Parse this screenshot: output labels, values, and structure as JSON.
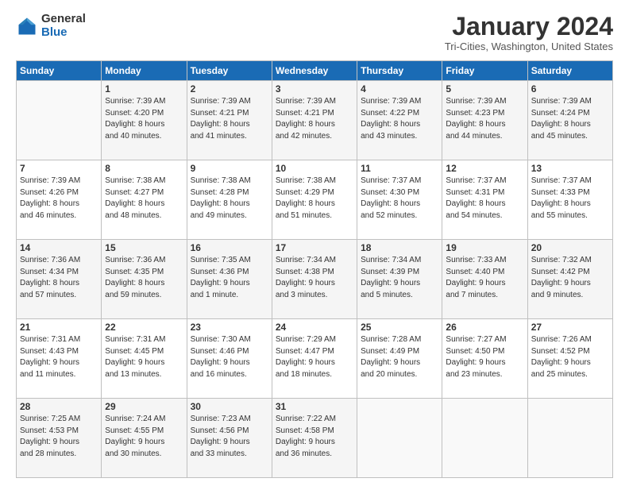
{
  "logo": {
    "general": "General",
    "blue": "Blue"
  },
  "header": {
    "title": "January 2024",
    "subtitle": "Tri-Cities, Washington, United States"
  },
  "weekdays": [
    "Sunday",
    "Monday",
    "Tuesday",
    "Wednesday",
    "Thursday",
    "Friday",
    "Saturday"
  ],
  "weeks": [
    [
      {
        "day": "",
        "info": ""
      },
      {
        "day": "1",
        "info": "Sunrise: 7:39 AM\nSunset: 4:20 PM\nDaylight: 8 hours\nand 40 minutes."
      },
      {
        "day": "2",
        "info": "Sunrise: 7:39 AM\nSunset: 4:21 PM\nDaylight: 8 hours\nand 41 minutes."
      },
      {
        "day": "3",
        "info": "Sunrise: 7:39 AM\nSunset: 4:21 PM\nDaylight: 8 hours\nand 42 minutes."
      },
      {
        "day": "4",
        "info": "Sunrise: 7:39 AM\nSunset: 4:22 PM\nDaylight: 8 hours\nand 43 minutes."
      },
      {
        "day": "5",
        "info": "Sunrise: 7:39 AM\nSunset: 4:23 PM\nDaylight: 8 hours\nand 44 minutes."
      },
      {
        "day": "6",
        "info": "Sunrise: 7:39 AM\nSunset: 4:24 PM\nDaylight: 8 hours\nand 45 minutes."
      }
    ],
    [
      {
        "day": "7",
        "info": "Sunrise: 7:39 AM\nSunset: 4:26 PM\nDaylight: 8 hours\nand 46 minutes."
      },
      {
        "day": "8",
        "info": "Sunrise: 7:38 AM\nSunset: 4:27 PM\nDaylight: 8 hours\nand 48 minutes."
      },
      {
        "day": "9",
        "info": "Sunrise: 7:38 AM\nSunset: 4:28 PM\nDaylight: 8 hours\nand 49 minutes."
      },
      {
        "day": "10",
        "info": "Sunrise: 7:38 AM\nSunset: 4:29 PM\nDaylight: 8 hours\nand 51 minutes."
      },
      {
        "day": "11",
        "info": "Sunrise: 7:37 AM\nSunset: 4:30 PM\nDaylight: 8 hours\nand 52 minutes."
      },
      {
        "day": "12",
        "info": "Sunrise: 7:37 AM\nSunset: 4:31 PM\nDaylight: 8 hours\nand 54 minutes."
      },
      {
        "day": "13",
        "info": "Sunrise: 7:37 AM\nSunset: 4:33 PM\nDaylight: 8 hours\nand 55 minutes."
      }
    ],
    [
      {
        "day": "14",
        "info": "Sunrise: 7:36 AM\nSunset: 4:34 PM\nDaylight: 8 hours\nand 57 minutes."
      },
      {
        "day": "15",
        "info": "Sunrise: 7:36 AM\nSunset: 4:35 PM\nDaylight: 8 hours\nand 59 minutes."
      },
      {
        "day": "16",
        "info": "Sunrise: 7:35 AM\nSunset: 4:36 PM\nDaylight: 9 hours\nand 1 minute."
      },
      {
        "day": "17",
        "info": "Sunrise: 7:34 AM\nSunset: 4:38 PM\nDaylight: 9 hours\nand 3 minutes."
      },
      {
        "day": "18",
        "info": "Sunrise: 7:34 AM\nSunset: 4:39 PM\nDaylight: 9 hours\nand 5 minutes."
      },
      {
        "day": "19",
        "info": "Sunrise: 7:33 AM\nSunset: 4:40 PM\nDaylight: 9 hours\nand 7 minutes."
      },
      {
        "day": "20",
        "info": "Sunrise: 7:32 AM\nSunset: 4:42 PM\nDaylight: 9 hours\nand 9 minutes."
      }
    ],
    [
      {
        "day": "21",
        "info": "Sunrise: 7:31 AM\nSunset: 4:43 PM\nDaylight: 9 hours\nand 11 minutes."
      },
      {
        "day": "22",
        "info": "Sunrise: 7:31 AM\nSunset: 4:45 PM\nDaylight: 9 hours\nand 13 minutes."
      },
      {
        "day": "23",
        "info": "Sunrise: 7:30 AM\nSunset: 4:46 PM\nDaylight: 9 hours\nand 16 minutes."
      },
      {
        "day": "24",
        "info": "Sunrise: 7:29 AM\nSunset: 4:47 PM\nDaylight: 9 hours\nand 18 minutes."
      },
      {
        "day": "25",
        "info": "Sunrise: 7:28 AM\nSunset: 4:49 PM\nDaylight: 9 hours\nand 20 minutes."
      },
      {
        "day": "26",
        "info": "Sunrise: 7:27 AM\nSunset: 4:50 PM\nDaylight: 9 hours\nand 23 minutes."
      },
      {
        "day": "27",
        "info": "Sunrise: 7:26 AM\nSunset: 4:52 PM\nDaylight: 9 hours\nand 25 minutes."
      }
    ],
    [
      {
        "day": "28",
        "info": "Sunrise: 7:25 AM\nSunset: 4:53 PM\nDaylight: 9 hours\nand 28 minutes."
      },
      {
        "day": "29",
        "info": "Sunrise: 7:24 AM\nSunset: 4:55 PM\nDaylight: 9 hours\nand 30 minutes."
      },
      {
        "day": "30",
        "info": "Sunrise: 7:23 AM\nSunset: 4:56 PM\nDaylight: 9 hours\nand 33 minutes."
      },
      {
        "day": "31",
        "info": "Sunrise: 7:22 AM\nSunset: 4:58 PM\nDaylight: 9 hours\nand 36 minutes."
      },
      {
        "day": "",
        "info": ""
      },
      {
        "day": "",
        "info": ""
      },
      {
        "day": "",
        "info": ""
      }
    ]
  ]
}
